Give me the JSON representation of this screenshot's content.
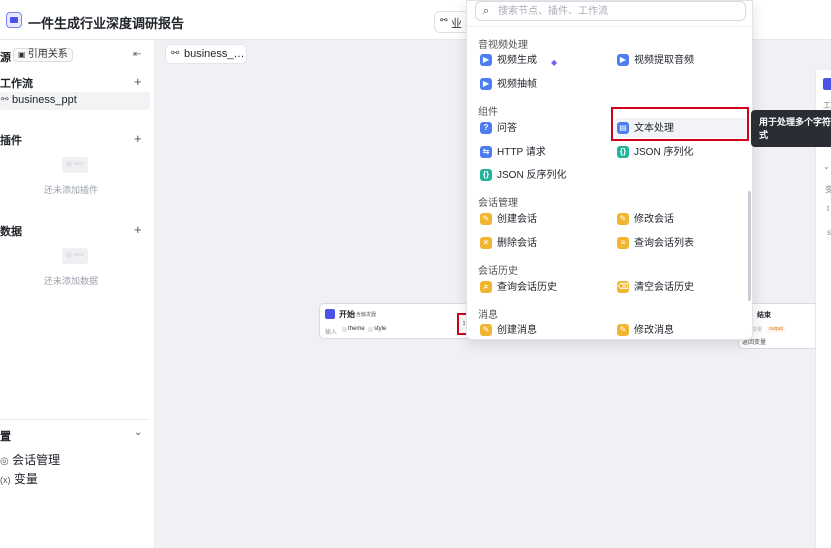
{
  "header": {
    "title": "一件生成行业深度调研报告",
    "tab_label": "业"
  },
  "sidebar": {
    "resources_label": "源",
    "ref_button": "引用关系",
    "workflow_section": "工作流",
    "workflow_item": "business_ppt",
    "plugin_section": "插件",
    "plugin_empty": "还未添加插件",
    "data_section": "数据",
    "data_empty": "还未添加数据",
    "settings_section": "置",
    "settings_items": [
      "会话管理",
      "变量"
    ]
  },
  "canvas": {
    "tab_label": "business_…",
    "start_node": {
      "title": "开始",
      "tag": "含触发器",
      "input_label": "输入",
      "params": [
        "theme",
        "style"
      ]
    },
    "handle_label": "1",
    "end_node": {
      "title": "结束",
      "output_tag": "output",
      "muted_label": "输出变量",
      "return_label": "返回变量"
    }
  },
  "picker": {
    "search_placeholder": "搜索节点、插件、工作流",
    "sections": [
      {
        "title": "音视频处理",
        "items": [
          {
            "label": "视频生成",
            "icon": "video-generate-icon",
            "color": "#4d7df0"
          },
          {
            "label": "视频提取音频",
            "icon": "video-audio-icon",
            "color": "#4d7df0"
          },
          {
            "label": "视频抽帧",
            "icon": "video-frame-icon",
            "color": "#4d7df0"
          }
        ]
      },
      {
        "title": "组件",
        "items": [
          {
            "label": "问答",
            "icon": "question-icon",
            "color": "#4d7df0"
          },
          {
            "label": "文本处理",
            "icon": "text-process-icon",
            "color": "#4d7df0"
          },
          {
            "label": "HTTP 请求",
            "icon": "http-icon",
            "color": "#4d7df0"
          },
          {
            "label": "JSON 序列化",
            "icon": "json-serialize-icon",
            "color": "#24b39b"
          },
          {
            "label": "JSON 反序列化",
            "icon": "json-deserialize-icon",
            "color": "#24b39b"
          }
        ]
      },
      {
        "title": "会话管理",
        "items": [
          {
            "label": "创建会话",
            "icon": "chat-create-icon",
            "color": "#f1b530"
          },
          {
            "label": "修改会话",
            "icon": "chat-edit-icon",
            "color": "#f1b530"
          },
          {
            "label": "删除会话",
            "icon": "chat-delete-icon",
            "color": "#f1b530"
          },
          {
            "label": "查询会话列表",
            "icon": "chat-list-icon",
            "color": "#f1b530"
          }
        ]
      },
      {
        "title": "会话历史",
        "items": [
          {
            "label": "查询会话历史",
            "icon": "history-query-icon",
            "color": "#f1b530"
          },
          {
            "label": "清空会话历史",
            "icon": "history-clear-icon",
            "color": "#f1b530"
          }
        ]
      },
      {
        "title": "消息",
        "items": [
          {
            "label": "创建消息",
            "icon": "message-create-icon",
            "color": "#f1b530"
          },
          {
            "label": "修改消息",
            "icon": "message-edit-icon",
            "color": "#f1b530"
          }
        ]
      }
    ]
  },
  "tooltip": {
    "line1": "用于处理多个字符",
    "line2": "式"
  },
  "right_panel": {
    "labels": [
      "工",
      "变",
      "t",
      "s"
    ]
  }
}
